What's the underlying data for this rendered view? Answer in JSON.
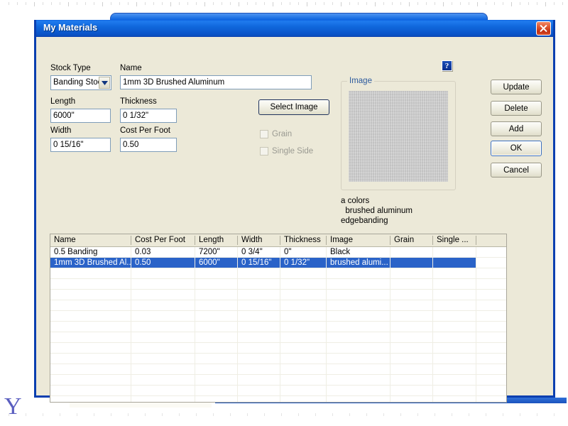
{
  "window": {
    "title": "My Materials",
    "close_label": "Close"
  },
  "form": {
    "stock_type": {
      "label": "Stock Type",
      "value": "Banding Stoc",
      "options": [
        "Banding Stoc"
      ]
    },
    "name": {
      "label": "Name",
      "value": "1mm 3D Brushed Aluminum",
      "placeholder": ""
    },
    "length": {
      "label": "Length",
      "value": "6000\""
    },
    "thickness": {
      "label": "Thickness",
      "value": "0 1/32\""
    },
    "width": {
      "label": "Width",
      "value": "0 15/16\""
    },
    "cost_per_foot": {
      "label": "Cost Per Foot",
      "value": "0.50"
    },
    "select_image_label": "Select Image",
    "grain": {
      "label": "Grain",
      "checked": false,
      "enabled": false
    },
    "single_side": {
      "label": "Single Side",
      "checked": false,
      "enabled": false
    },
    "help_label": "?"
  },
  "image_panel": {
    "legend": "Image",
    "swatch_color": "#c9c9c9",
    "caption_lines": [
      "a colors",
      "  brushed aluminum",
      "edgebanding"
    ]
  },
  "actions": {
    "update": "Update",
    "delete": "Delete",
    "add": "Add",
    "ok": "OK",
    "cancel": "Cancel"
  },
  "grid": {
    "columns": [
      "Name",
      "Cost Per Foot",
      "Length",
      "Width",
      "Thickness",
      "Image",
      "Grain",
      "Single ..."
    ],
    "rows": [
      {
        "selected": false,
        "cells": [
          "0.5 Banding",
          "0.03",
          "7200\"",
          "0 3/4\"",
          "0\"",
          "Black",
          "",
          ""
        ]
      },
      {
        "selected": true,
        "cells": [
          "1mm 3D Brushed Al...",
          "0.50",
          "6000\"",
          "0 15/16\"",
          "0 1/32\"",
          "brushed alumi...",
          "",
          ""
        ]
      }
    ],
    "empty_row_count": 13
  },
  "colors": {
    "dialog_face": "#ece9d8",
    "title_blue": "#0a53c8",
    "selection_blue": "#2a63c8",
    "legend_blue": "#2d5b9e",
    "disabled_text": "#9a9a92"
  },
  "desktop": {
    "stray_glyph": "Y"
  }
}
